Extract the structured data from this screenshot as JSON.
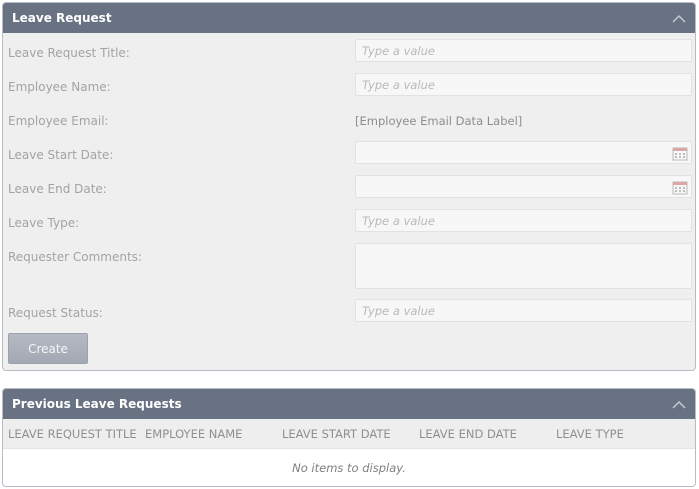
{
  "form_panel": {
    "title": "Leave Request",
    "fields": {
      "title": {
        "label": "Leave Request Title:",
        "placeholder": "Type a value"
      },
      "employee_name": {
        "label": "Employee Name:",
        "placeholder": "Type a value"
      },
      "employee_email": {
        "label": "Employee Email:",
        "value": "[Employee Email Data Label]"
      },
      "start_date": {
        "label": "Leave Start Date:",
        "value": ""
      },
      "end_date": {
        "label": "Leave End Date:",
        "value": ""
      },
      "leave_type": {
        "label": "Leave Type:",
        "placeholder": "Type a value"
      },
      "comments": {
        "label": "Requester Comments:",
        "value": ""
      },
      "status": {
        "label": "Request Status:",
        "placeholder": "Type a value"
      }
    },
    "create_label": "Create"
  },
  "list_panel": {
    "title": "Previous Leave Requests",
    "columns": [
      "LEAVE REQUEST TITLE",
      "EMPLOYEE NAME",
      "LEAVE START DATE",
      "LEAVE END DATE",
      "LEAVE TYPE"
    ],
    "empty_message": "No items to display."
  },
  "icons": {
    "collapse": "chevron-up-icon",
    "date_picker": "calendar-icon"
  },
  "colors": {
    "header_bg": "#687283",
    "button_bg": "#abb1bb"
  }
}
